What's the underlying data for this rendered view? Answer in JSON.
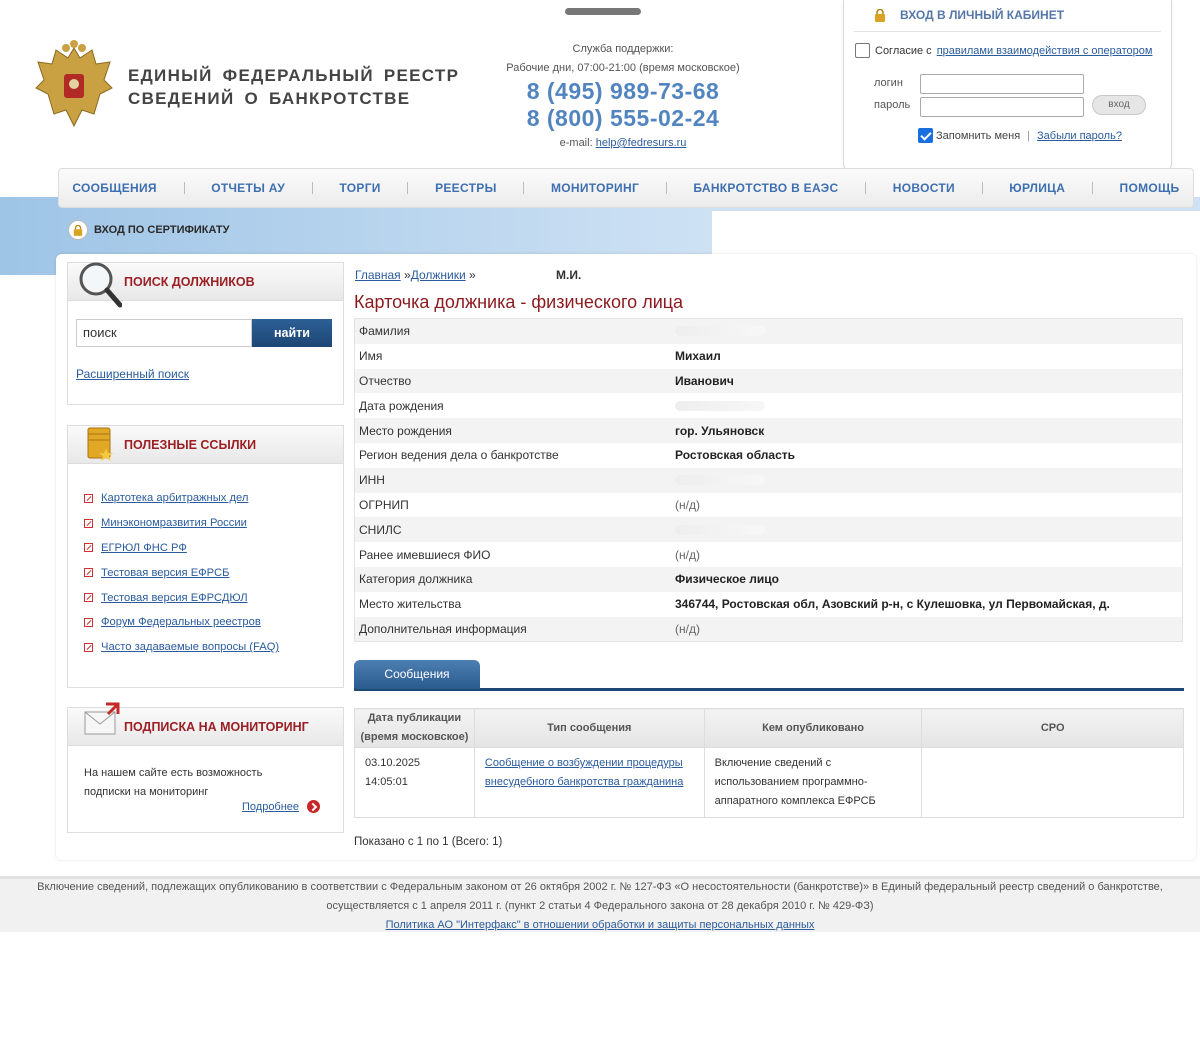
{
  "brand": {
    "line1": "ЕДИНЫЙ ФЕДЕРАЛЬНЫЙ РЕЕСТР",
    "line2": "СВЕДЕНИЙ О БАНКРОТСТВЕ"
  },
  "support": {
    "title": "Служба поддержки:",
    "hours": "Рабочие дни, 07:00-21:00 (время московское)",
    "phone1": "8 (495) 989-73-68",
    "phone2": "8 (800) 555-02-24",
    "email_label": "e-mail:",
    "email": "help@fedresurs.ru"
  },
  "login": {
    "title": "ВХОД В ЛИЧНЫЙ КАБИНЕТ",
    "agree_prefix": "Согласие с",
    "agree_link": "правилами взаимодействия с оператором",
    "login_label": "логин",
    "password_label": "пароль",
    "submit": "вход",
    "remember": "Запомнить меня",
    "separator": "|",
    "forgot": "Забыли пароль?"
  },
  "nav": [
    "СООБЩЕНИЯ",
    "ОТЧЕТЫ АУ",
    "ТОРГИ",
    "РЕЕСТРЫ",
    "МОНИТОРИНГ",
    "БАНКРОТСТВО В ЕАЭС",
    "НОВОСТИ",
    "ЮРЛИЦА",
    "ПОМОЩЬ"
  ],
  "cert_login": "ВХОД ПО СЕРТИФИКАТУ",
  "search": {
    "title": "ПОИСК ДОЛЖНИКОВ",
    "value": "поиск",
    "button": "найти",
    "advanced": "Расширенный поиск"
  },
  "links": {
    "title": "ПОЛЕЗНЫЕ ССЫЛКИ",
    "items": [
      "Картотека арбитражных дел",
      "Минэкономразвития России",
      "ЕГРЮЛ ФНС РФ",
      "Тестовая версия ЕФРСБ",
      "Тестовая версия ЕФРСДЮЛ",
      "Форум Федеральных реестров",
      "Часто задаваемые вопросы (FAQ)"
    ]
  },
  "monitor": {
    "title": "ПОДПИСКА НА МОНИТОРИНГ",
    "text": "На нашем сайте есть возможность подписки на мониторинг",
    "more": "Подробнее"
  },
  "breadcrumb": {
    "home": "Главная",
    "sep1": " »",
    "debtors": "Должники",
    "sep2": " »",
    "name": "М.И."
  },
  "page_title": "Карточка должника - физического лица",
  "card": [
    {
      "k": "Фамилия",
      "v": ""
    },
    {
      "k": "Имя",
      "v": "Михаил"
    },
    {
      "k": "Отчество",
      "v": "Иванович"
    },
    {
      "k": "Дата рождения",
      "v": ""
    },
    {
      "k": "Место рождения",
      "v": "гор. Ульяновск"
    },
    {
      "k": "Регион ведения дела о банкротстве",
      "v": "Ростовская область"
    },
    {
      "k": "ИНН",
      "v": ""
    },
    {
      "k": "ОГРНИП",
      "v": "(н/д)"
    },
    {
      "k": "СНИЛС",
      "v": ""
    },
    {
      "k": "Ранее имевшиеся ФИО",
      "v": "(н/д)"
    },
    {
      "k": "Категория должника",
      "v": "Физическое лицо"
    },
    {
      "k": "Место жительства",
      "v": "346744, Ростовская обл, Азовский р-н, с Кулешовка, ул Первомайская, д."
    },
    {
      "k": "Дополнительная информация",
      "v": "(н/д)"
    }
  ],
  "tab": "Сообщения",
  "table": {
    "headers": [
      "Дата публикации (время московское)",
      "Тип сообщения",
      "Кем опубликовано",
      "СРО"
    ],
    "rows": [
      {
        "date": "03.10.2025 14:05:01",
        "type": "Сообщение о возбуждении процедуры внесудебного банкротства гражданина",
        "publisher": "Включение сведений с использованием программно-аппаратного комплекса ЕФРСБ",
        "sro": ""
      }
    ]
  },
  "shown": "Показано с 1 по 1 (Всего: 1)",
  "footer": {
    "line1": "Включение сведений, подлежащих опубликованию в соответствии с Федеральным законом от 26 октября 2002 г. № 127-ФЗ «О несостоятельности (банкротстве)» в Единый федеральный реестр сведений о банкротстве,",
    "line2": "осуществляется с 1 апреля 2011 г. (пункт 2 статьи 4 Федерального закона от 28 декабря 2010 г. № 429-ФЗ)",
    "policy": "Политика АО \"Интерфакс\" в отношении обработки и защиты персональных данных"
  }
}
